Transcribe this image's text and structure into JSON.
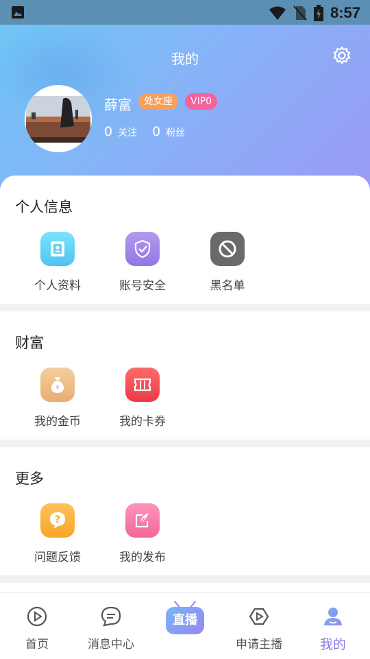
{
  "status_bar": {
    "time": "8:57"
  },
  "header": {
    "title": "我的",
    "username": "薛富",
    "zodiac_badge": "处女座",
    "vip_badge": "VIP0",
    "follow_count": "0",
    "follow_label": "关注",
    "fans_count": "0",
    "fans_label": "粉丝"
  },
  "sections": [
    {
      "title": "个人信息",
      "items": [
        {
          "label": "个人资料",
          "icon": "profile-card-icon",
          "color": "#5fd0f6"
        },
        {
          "label": "账号安全",
          "icon": "shield-check-icon",
          "color": "#9d86ea"
        },
        {
          "label": "黑名单",
          "icon": "block-icon",
          "color": "#6a6a6a"
        }
      ]
    },
    {
      "title": "财富",
      "items": [
        {
          "label": "我的金币",
          "icon": "money-bag-icon",
          "color": "#eebb86"
        },
        {
          "label": "我的卡券",
          "icon": "ticket-icon",
          "color": "#f2484f"
        }
      ]
    },
    {
      "title": "更多",
      "items": [
        {
          "label": "问题反馈",
          "icon": "question-bubble-icon",
          "color": "#fbb13c"
        },
        {
          "label": "我的发布",
          "icon": "feather-edit-icon",
          "color": "#f87aa6"
        }
      ]
    }
  ],
  "bottom_nav": {
    "items": [
      {
        "label": "首页",
        "icon": "home-play-icon"
      },
      {
        "label": "消息中心",
        "icon": "message-icon"
      },
      {
        "label": "直播",
        "icon": "live-tv-icon"
      },
      {
        "label": "申请主播",
        "icon": "apply-anchor-icon"
      },
      {
        "label": "我的",
        "icon": "user-icon",
        "active": true
      }
    ],
    "active_color": "#8a78ea"
  }
}
